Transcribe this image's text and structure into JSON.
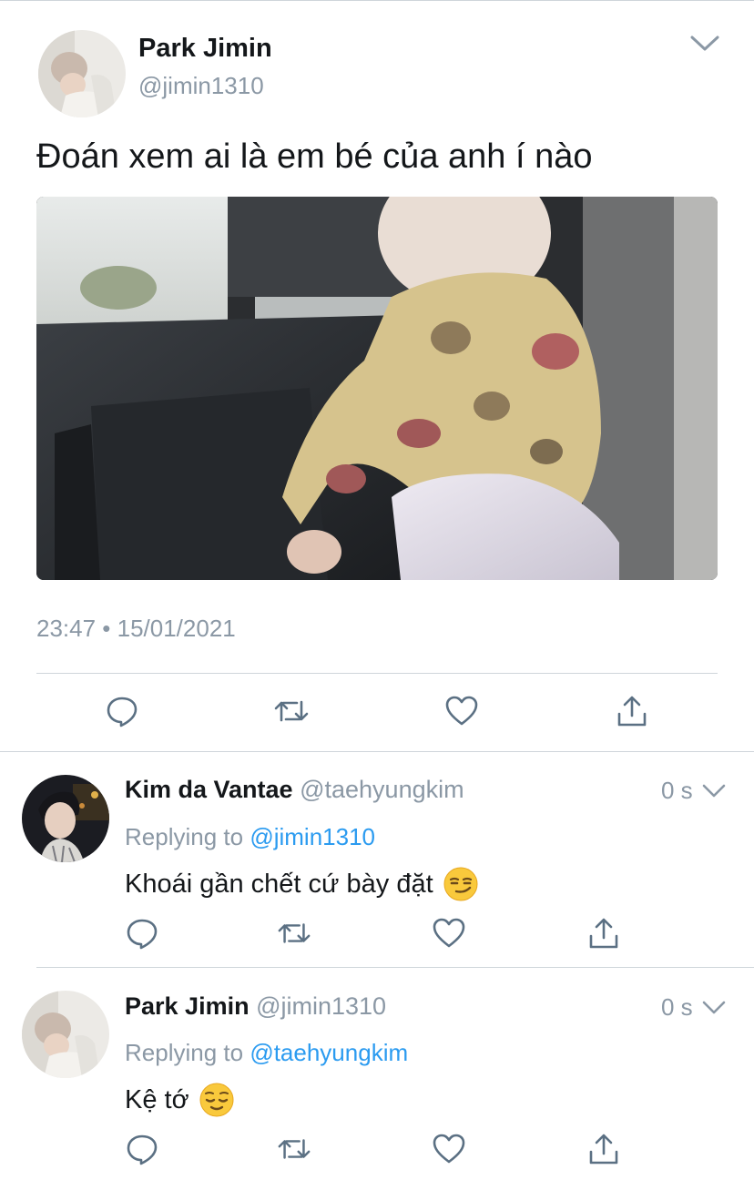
{
  "main_tweet": {
    "author_name": "Park Jimin",
    "author_handle": "@jimin1310",
    "text": "Đoán xem ai là em bé của anh í nào",
    "timestamp": "23:47 • 15/01/2021",
    "media_icon": "baby-in-car-photo",
    "avatar_icon": "profile-photo",
    "actions": [
      "reply-icon",
      "retweet-icon",
      "like-icon",
      "share-icon"
    ]
  },
  "replies": [
    {
      "author_name": "Kim da Vantae",
      "author_handle": "@taehyungkim",
      "time": "0 s",
      "replying_prefix": "Replying to",
      "replying_to": "@jimin1310",
      "text": "Khoái gần chết cứ bày đặt",
      "emoji": "smirking-face-emoji"
    },
    {
      "author_name": "Park Jimin",
      "author_handle": "@jimin1310",
      "time": "0 s",
      "replying_prefix": "Replying to",
      "replying_to": "@taehyungkim",
      "text": "Kệ tớ",
      "emoji": "relieved-face-emoji"
    }
  ],
  "colors": {
    "text": "#14171a",
    "secondary": "#8b98a5",
    "link": "#2b9bf0",
    "divider": "#cfd5da",
    "icon": "#5b7083"
  }
}
